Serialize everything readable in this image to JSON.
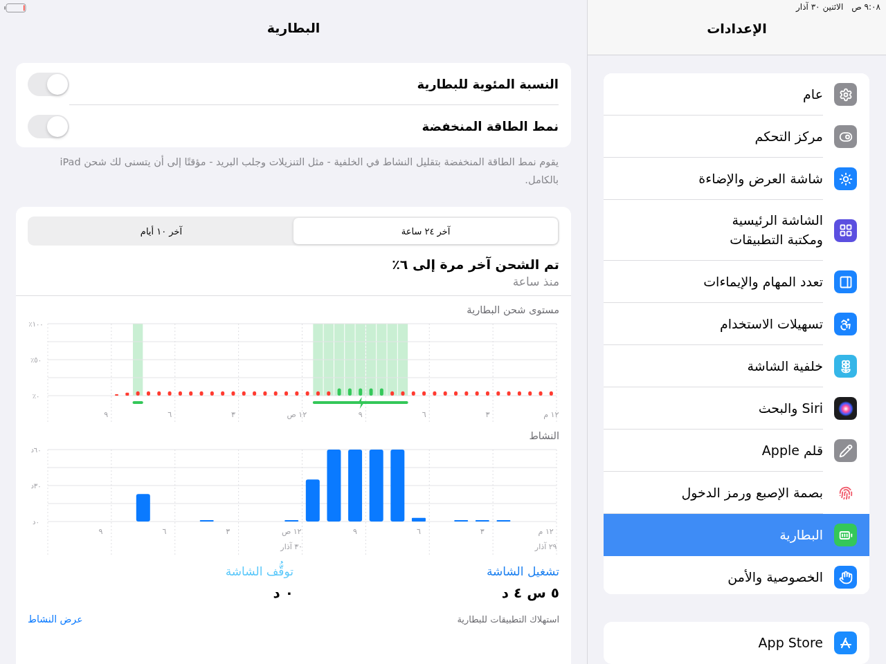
{
  "status_bar": {
    "time": "٩:٠٨ ص",
    "date": "الاثنين ٣٠ آذار"
  },
  "sidebar": {
    "title": "الإعدادات",
    "groups": [
      {
        "items": [
          {
            "label": "عام",
            "color": "#8e8e93",
            "selected": false
          },
          {
            "label": "مركز التحكم",
            "color": "#8e8e93",
            "selected": false
          },
          {
            "label": "شاشة العرض والإضاءة",
            "color": "#1a84ff",
            "selected": false
          },
          {
            "label": "الشاشة الرئيسية\nومكتبة التطبيقات",
            "color": "#5b4fe0",
            "selected": false
          },
          {
            "label": "تعدد المهام والإيماءات",
            "color": "#1a84ff",
            "selected": false
          },
          {
            "label": "تسهيلات الاستخدام",
            "color": "#1a84ff",
            "selected": false
          },
          {
            "label": "خلفية الشاشة",
            "color": "#35b6e8",
            "selected": false
          },
          {
            "label": "Siri والبحث",
            "color": "#1c1c1e",
            "selected": false
          },
          {
            "label": "قلم Apple",
            "color": "#8e8e93",
            "selected": false
          },
          {
            "label": "بصمة الإصبع ورمز الدخول",
            "color": "#ffffff",
            "selected": false
          },
          {
            "label": "البطارية",
            "color": "#34c759",
            "selected": true
          },
          {
            "label": "الخصوصية والأمن",
            "color": "#1a84ff",
            "selected": false
          }
        ]
      },
      {
        "items": [
          {
            "label": "App Store",
            "color": "#1a8cff",
            "selected": false
          }
        ]
      }
    ]
  },
  "detail": {
    "title": "البطارية",
    "toggles": [
      {
        "label": "النسبة المئوية للبطارية",
        "on": false
      },
      {
        "label": "نمط الطاقة المنخفضة",
        "on": false
      }
    ],
    "footnote": "يقوم نمط الطاقة المنخفضة بتقليل النشاط في الخلفية - مثل التنزيلات وجلب البريد - مؤقتًا إلى أن يتسنى لك شحن iPad بالكامل.",
    "usage": {
      "segments": [
        {
          "label": "آخر ٢٤ ساعة",
          "selected": true
        },
        {
          "label": "آخر ١٠ أيام",
          "selected": false
        }
      ],
      "last_charge": "تم الشحن آخر مرة إلى ٦٪",
      "last_charge_time": "منذ ساعة",
      "battery_chart": {
        "chart_data": {
          "type": "bar",
          "title": "مستوى شحن البطارية",
          "categories": [
            null,
            null,
            null,
            null,
            null,
            "٩",
            null,
            null,
            null,
            null,
            null,
            "٦",
            null,
            null,
            null,
            null,
            null,
            "٣",
            null,
            null,
            null,
            null,
            null,
            "١٢ ص",
            null,
            null,
            null,
            null,
            null,
            "٩",
            null,
            null,
            null,
            null,
            null,
            "٦",
            null,
            null,
            null,
            null,
            null,
            "٣",
            null,
            null,
            null,
            null,
            null,
            "١٢ م"
          ],
          "series": [
            {
              "color": "#c9efd3",
              "values": [
                null,
                null,
                null,
                null,
                null,
                null,
                null,
                null,
                100,
                null,
                null,
                null,
                null,
                null,
                null,
                null,
                null,
                null,
                null,
                null,
                null,
                null,
                null,
                null,
                null,
                100,
                100,
                100,
                100,
                100,
                100,
                100,
                100,
                100,
                null,
                null,
                null,
                null,
                null,
                null,
                null,
                null,
                null,
                null,
                null,
                null,
                null,
                null
              ]
            },
            {
              "color": "#ff3b30",
              "values": [
                null,
                null,
                null,
                null,
                null,
                null,
                2,
                4,
                6,
                6,
                6,
                6,
                6,
                6,
                6,
                6,
                6,
                6,
                6,
                6,
                6,
                6,
                6,
                6,
                6,
                6,
                6,
                null,
                null,
                null,
                null,
                null,
                6,
                6,
                6,
                6,
                6,
                6,
                6,
                6,
                6,
                6,
                6,
                6,
                6,
                6,
                6,
                6
              ]
            },
            {
              "color": "#34c759",
              "values": [
                null,
                null,
                null,
                null,
                null,
                null,
                null,
                null,
                null,
                null,
                null,
                null,
                null,
                null,
                null,
                null,
                null,
                null,
                null,
                null,
                null,
                null,
                null,
                null,
                null,
                null,
                null,
                10,
                10,
                10,
                10,
                10,
                null,
                null,
                null,
                null,
                null,
                null,
                null,
                null,
                null,
                null,
                null,
                null,
                null,
                null,
                null,
                null
              ]
            }
          ],
          "ylim": [
            0,
            100
          ],
          "yticks": [
            {
              "value": 0,
              "label": "٠٪"
            },
            {
              "value": 50,
              "label": "٥٠٪"
            },
            {
              "value": 100,
              "label": "١٠٠٪"
            }
          ]
        }
      },
      "activity_chart": {
        "chart_data": {
          "type": "bar",
          "title": "النشاط",
          "categories": [
            null,
            null,
            "٩",
            null,
            null,
            "٦",
            null,
            null,
            "٣",
            null,
            null,
            "١٢ ص\n٣٠ آذار",
            null,
            null,
            "٩",
            null,
            null,
            "٦",
            null,
            null,
            "٣",
            null,
            null,
            "١٢ م\n٢٩ آذار"
          ],
          "series": [
            {
              "color": "#0a7aff",
              "values": [
                null,
                null,
                null,
                null,
                23,
                null,
                null,
                0.5,
                null,
                null,
                null,
                0.5,
                35,
                60,
                60,
                60,
                60,
                3,
                null,
                0.5,
                0.5,
                0.5,
                null,
                null
              ]
            }
          ],
          "ylim": [
            0,
            60
          ],
          "yticks": [
            {
              "value": 0,
              "label": "٠د"
            },
            {
              "value": 30,
              "label": "٣٠د"
            },
            {
              "value": 60,
              "label": "٦٠د"
            }
          ]
        }
      },
      "screen_stats": [
        {
          "label": "تشغيل الشاشة",
          "value": "٥ س ٤ د",
          "color": "#1a7ff0"
        },
        {
          "label": "توقُّف الشاشة",
          "value": "٠ د",
          "color": "#5ac8fa"
        }
      ],
      "app_usage": {
        "label": "استهلاك التطبيقات للبطارية",
        "link": "عرض النشاط"
      }
    }
  }
}
